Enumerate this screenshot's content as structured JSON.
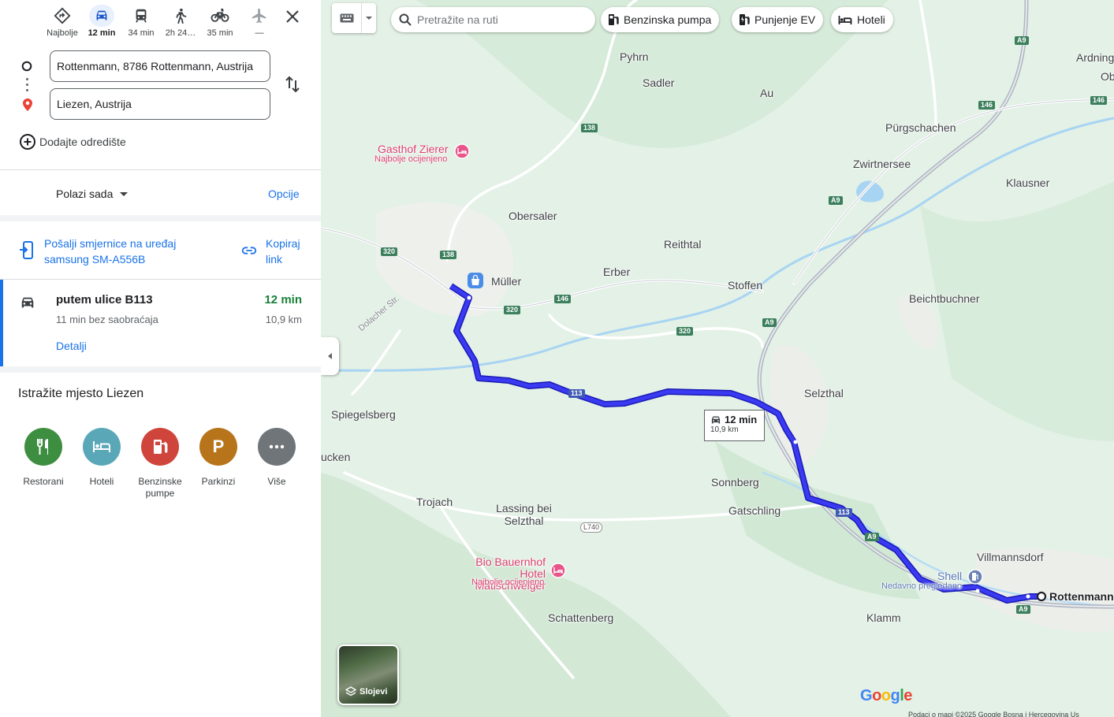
{
  "travel_modes": [
    {
      "label": "Najbolje",
      "icon": "best-route-icon"
    },
    {
      "label": "12 min",
      "icon": "car-icon",
      "active": true
    },
    {
      "label": "34 min",
      "icon": "transit-icon"
    },
    {
      "label": "2h 24…",
      "icon": "walk-icon"
    },
    {
      "label": "35 min",
      "icon": "bike-icon"
    },
    {
      "label": "—",
      "icon": "flight-icon"
    }
  ],
  "origin": {
    "value": "Rottenmann, 8786 Rottenmann, Austrija"
  },
  "destination": {
    "value": "Liezen, Austrija"
  },
  "add_destination": "Dodajte odredište",
  "depart": {
    "label": "Polazi sada",
    "options": "Opcije"
  },
  "share": {
    "send_label": "Pošalji smjernice na uređaj samsung SM-A556B",
    "copy_label": "Kopiraj link"
  },
  "route": {
    "title": "putem ulice B113",
    "subtitle": "11 min bez saobraćaja",
    "time": "12 min",
    "distance": "10,9 km",
    "details": "Detalji"
  },
  "explore": {
    "title": "Istražite mjesto Liezen",
    "categories": [
      {
        "label": "Restorani",
        "color": "#3e8e41",
        "icon": "restaurant-icon"
      },
      {
        "label": "Hoteli",
        "color": "#5aa7b8",
        "icon": "hotel-icon"
      },
      {
        "label": "Benzinske pumpe",
        "color": "#d0453b",
        "icon": "gas-station-icon"
      },
      {
        "label": "Parkinzi",
        "color": "#b8741a",
        "icon": "parking-icon",
        "glyph": "P"
      },
      {
        "label": "Više",
        "color": "#70757a",
        "icon": "more-icon"
      }
    ]
  },
  "map": {
    "search_placeholder": "Pretražite na ruti",
    "chips": [
      "Benzinska pumpa",
      "Punjenje EV",
      "Hoteli"
    ],
    "route_label": {
      "time": "12 min",
      "distance": "10,9 km"
    },
    "layers_label": "Slojevi",
    "google": "Google",
    "footer": "Podaci o mapi ©2025 Google    Bosna i Hercegovina    Us",
    "places": [
      "Pyhrn",
      "Sadler",
      "Au",
      "Ardning",
      "Ob",
      "Pürgschachen",
      "Zwirtnersee",
      "Klausner",
      "Obersaler",
      "Reithtal",
      "Müller",
      "Erber",
      "Stoffen",
      "Beichtbuchner",
      "Selzthal",
      "Spiegelsberg",
      "ucken",
      "Sonnberg",
      "Trojach",
      "Lassing bei Selzthal",
      "Gatschling",
      "Villmannsdorf",
      "Schattenberg",
      "Klamm",
      "Rottenmann"
    ],
    "pois": [
      {
        "name": "Gasthof Zierer",
        "sub": "Najbolje ocijenjeno"
      },
      {
        "name": "Bio Bauernhof Hotel Matlschweiger",
        "sub": "Najbolje ocijenjeno"
      },
      {
        "name": "Shell",
        "sub": "Nedavno pregledano"
      }
    ],
    "roads": [
      "A9",
      "146",
      "138",
      "320",
      "113",
      "L740"
    ],
    "streets": [
      "Dolacher Str."
    ],
    "colors": {
      "route": "#3333ee",
      "accent": "#1a73e8",
      "highway": "#aeb6c1"
    }
  }
}
